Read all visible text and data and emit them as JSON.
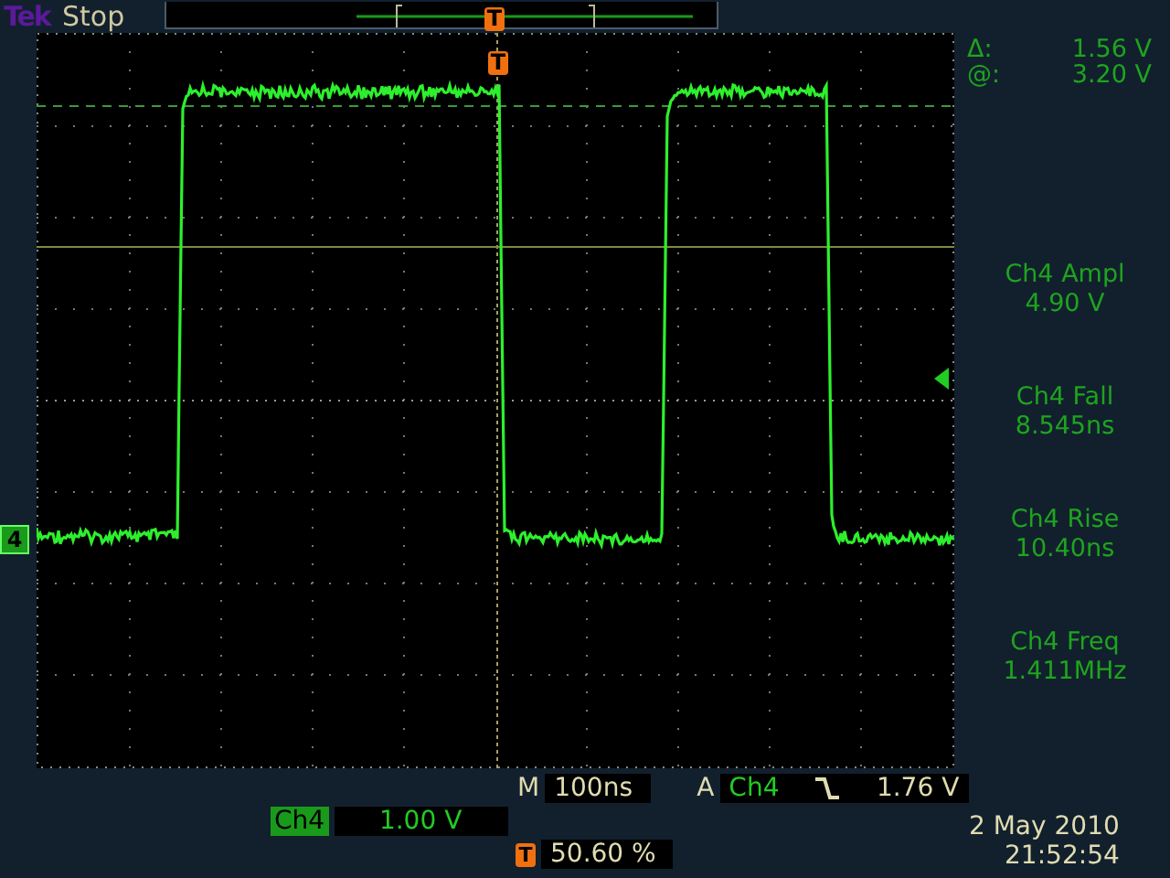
{
  "header": {
    "brand": "Tek",
    "state": "Stop"
  },
  "record_view": {
    "trigger_label": "T"
  },
  "graticule": {
    "trigger_label": "T",
    "channel_marker": "4"
  },
  "cursors": [
    {
      "symbol": "Δ:",
      "value": "1.56 V"
    },
    {
      "symbol": "@:",
      "value": "3.20 V"
    }
  ],
  "measurements": [
    {
      "label": "Ch4 Ampl",
      "value": "4.90 V"
    },
    {
      "label": "Ch4 Fall",
      "value": "8.545ns"
    },
    {
      "label": "Ch4 Rise",
      "value": "10.40ns"
    },
    {
      "label": "Ch4 Freq",
      "value": "1.411MHz"
    }
  ],
  "timebase": {
    "label": "M",
    "value": "100ns"
  },
  "trigger": {
    "label": "A",
    "source": "Ch4",
    "falling_edge": true,
    "voltage": "1.76 V"
  },
  "channel": {
    "name": "Ch4",
    "scale": "1.00 V"
  },
  "trigger_position": {
    "icon": "T",
    "value": "50.60 %"
  },
  "clock": {
    "date": "2 May 2010",
    "time": "21:52:54"
  }
}
